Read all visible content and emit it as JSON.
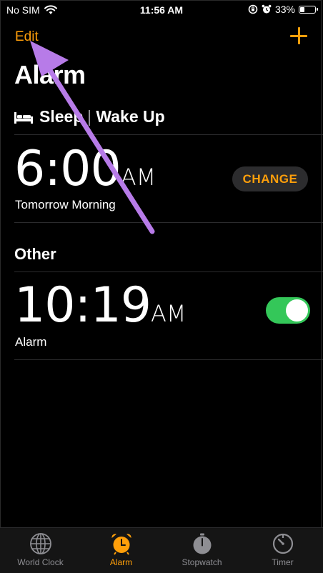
{
  "status_bar": {
    "carrier": "No SIM",
    "time": "11:56 AM",
    "battery": "33%"
  },
  "nav": {
    "edit_label": "Edit"
  },
  "page_title": "Alarm",
  "sleep": {
    "label_left": "Sleep",
    "label_right": "Wake Up",
    "time": "6:00",
    "ampm": "AM",
    "subtitle": "Tomorrow Morning",
    "change_label": "CHANGE"
  },
  "other": {
    "section_title": "Other",
    "alarm": {
      "time": "10:19",
      "ampm": "AM",
      "label": "Alarm",
      "enabled": true
    }
  },
  "tabs": [
    {
      "label": "World Clock",
      "icon": "globe-icon"
    },
    {
      "label": "Alarm",
      "icon": "alarm-clock-icon",
      "active": true
    },
    {
      "label": "Stopwatch",
      "icon": "stopwatch-icon"
    },
    {
      "label": "Timer",
      "icon": "timer-icon"
    }
  ],
  "colors": {
    "accent": "#ff9f0a",
    "toggle_on": "#34c759",
    "annotation_arrow": "#b77be8"
  },
  "battery_level": 0.33
}
